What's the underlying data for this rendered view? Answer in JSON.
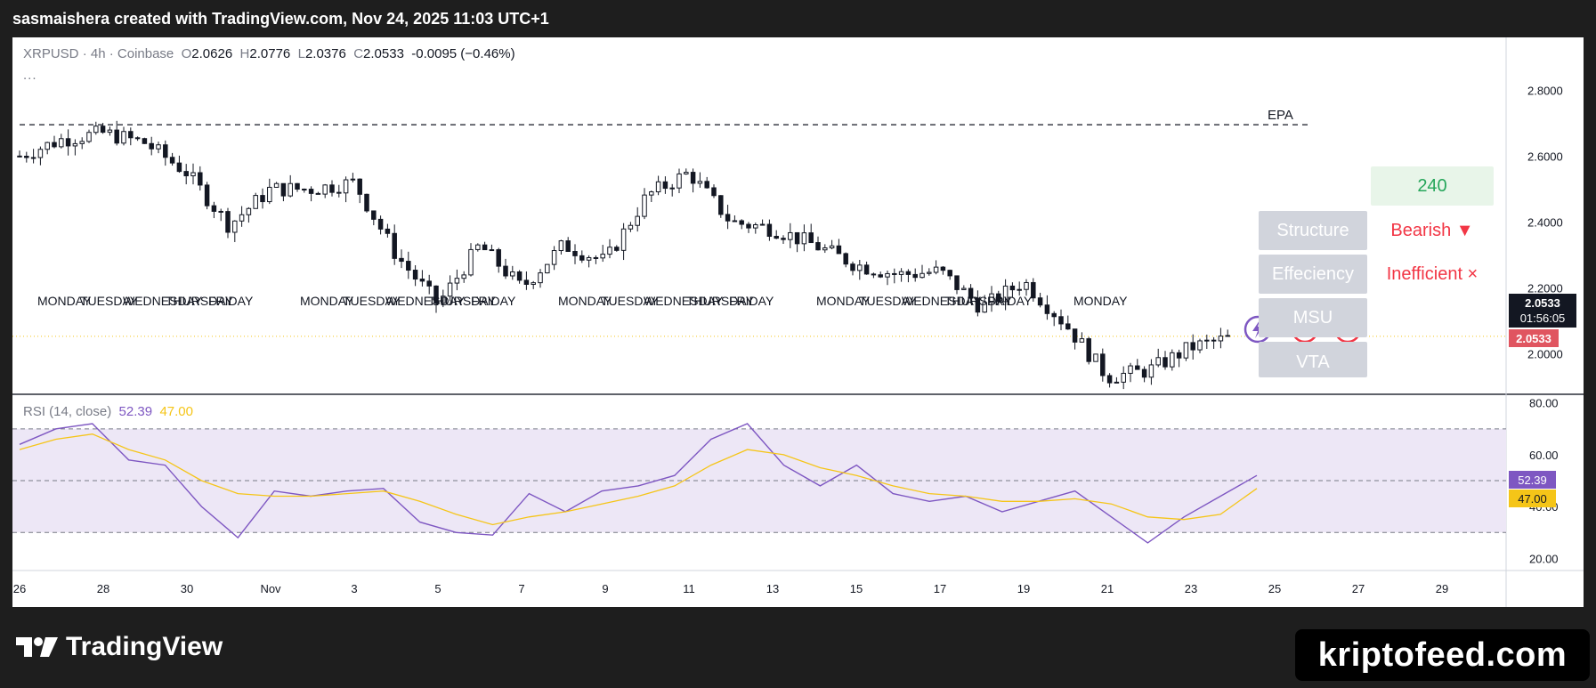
{
  "header": {
    "attribution": "sasmaishera created with TradingView.com, Nov 24, 2025 11:03 UTC+1"
  },
  "legend": {
    "symbol": "XRPUSD",
    "interval": "4h",
    "exchange": "Coinbase",
    "sep": "·",
    "open_label": "O",
    "open": "2.0626",
    "high_label": "H",
    "high": "2.0776",
    "low_label": "L",
    "low": "2.0376",
    "close_label": "C",
    "close": "2.0533",
    "change": "-0.0095 (−0.46%)",
    "more": "..."
  },
  "rsi_legend": {
    "label": "RSI (14, close)",
    "rsi_value": "52.39",
    "ma_value": "47.00"
  },
  "annotations": {
    "epa": "EPA",
    "day_labels": [
      "MONDAY",
      "TUESDAY",
      "WEDNESDAY",
      "THURSDAY",
      "FRIDAY"
    ]
  },
  "panel": {
    "timeframe": "240",
    "rows": [
      {
        "label": "Structure",
        "value": "Bearish ▼"
      },
      {
        "label": "Effeciency",
        "value": "Inefficient ×"
      },
      {
        "label": "MSU",
        "value": ""
      },
      {
        "label": "VTA",
        "value": ""
      }
    ]
  },
  "price_tags": {
    "last_price": "2.0533",
    "countdown": "01:56:05",
    "prev_close": "2.0533",
    "rsi": "52.39",
    "rsi_ma": "47.00"
  },
  "footer": {
    "logo_text": "TradingView",
    "brand": "kriptofeed.com"
  },
  "colors": {
    "up": "#131722",
    "down": "#131722",
    "rsi_line": "#7e57c2",
    "rsi_ma": "#f5c518",
    "rsi_band": "#ede7f6",
    "bearish": "#f23645",
    "timeframe_green": "#26a65b"
  },
  "chart_data": {
    "type": "candlestick",
    "symbol": "XRPUSD",
    "interval": "4h",
    "price_axis_ticks": [
      2.0,
      2.2,
      2.4,
      2.6,
      2.8
    ],
    "price_ylim": [
      1.88,
      2.96
    ],
    "epa_level": 2.695,
    "last_close": 2.0533,
    "x_tick_labels": [
      "26",
      "28",
      "30",
      "Nov",
      "3",
      "5",
      "7",
      "9",
      "11",
      "13",
      "15",
      "17",
      "19",
      "21",
      "23",
      "25",
      "27",
      "29"
    ],
    "price_path": [
      [
        "Oct 26",
        2.6
      ],
      [
        "Oct 27",
        2.65
      ],
      [
        "Oct 28",
        2.67
      ],
      [
        "Oct 29",
        2.64
      ],
      [
        "Oct 30",
        2.55
      ],
      [
        "Oct 31",
        2.39
      ],
      [
        "Nov 1",
        2.5
      ],
      [
        "Nov 2",
        2.5
      ],
      [
        "Nov 3",
        2.52
      ],
      [
        "Nov 4",
        2.3
      ],
      [
        "Nov 5",
        2.15
      ],
      [
        "Nov 6",
        2.33
      ],
      [
        "Nov 7",
        2.2
      ],
      [
        "Nov 8",
        2.33
      ],
      [
        "Nov 9",
        2.28
      ],
      [
        "Nov 10",
        2.48
      ],
      [
        "Nov 11",
        2.55
      ],
      [
        "Nov 12",
        2.4
      ],
      [
        "Nov 13",
        2.38
      ],
      [
        "Nov 14",
        2.33
      ],
      [
        "Nov 15",
        2.27
      ],
      [
        "Nov 16",
        2.24
      ],
      [
        "Nov 17",
        2.25
      ],
      [
        "Nov 18",
        2.14
      ],
      [
        "Nov 19",
        2.22
      ],
      [
        "Nov 20",
        2.09
      ],
      [
        "Nov 21",
        1.93
      ],
      [
        "Nov 22",
        1.95
      ],
      [
        "Nov 23",
        2.02
      ],
      [
        "Nov 24",
        2.05
      ]
    ],
    "rsi_axis_ticks": [
      20,
      40,
      60,
      80
    ],
    "rsi_ylim": [
      16,
      83
    ],
    "rsi_bands": [
      30,
      50,
      70
    ],
    "rsi_series": [
      {
        "name": "RSI (14, close)",
        "values": [
          64,
          70,
          72,
          58,
          56,
          40,
          28,
          46,
          44,
          46,
          47,
          34,
          30,
          29,
          45,
          38,
          46,
          48,
          52,
          66,
          72,
          56,
          48,
          56,
          45,
          42,
          44,
          38,
          42,
          46,
          36,
          26,
          36,
          44,
          52
        ]
      },
      {
        "name": "RSI MA",
        "values": [
          62,
          66,
          68,
          62,
          58,
          50,
          45,
          44,
          44,
          45,
          46,
          42,
          37,
          33,
          36,
          38,
          41,
          44,
          48,
          56,
          62,
          60,
          55,
          52,
          48,
          45,
          44,
          42,
          42,
          43,
          41,
          36,
          35,
          37,
          47
        ]
      }
    ]
  }
}
